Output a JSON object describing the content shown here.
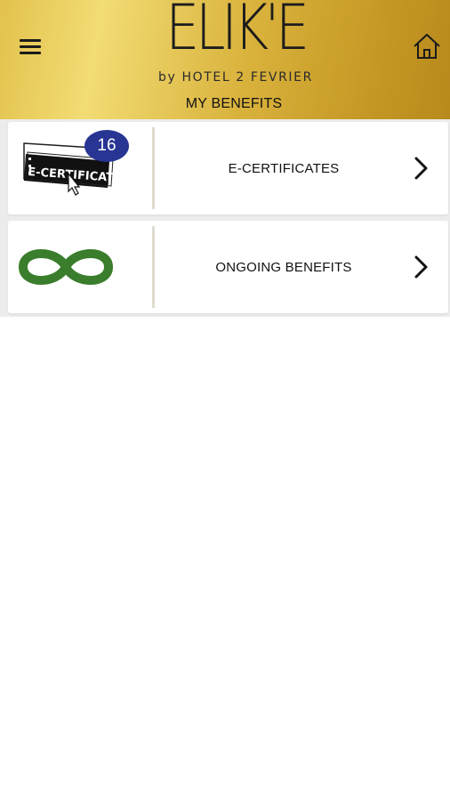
{
  "header": {
    "logo_word": "ELIK'E",
    "logo_sub": "by HOTEL 2 FEVRIER",
    "title": "MY BENEFITS",
    "menu_icon": "hamburger-menu-icon",
    "home_icon": "home-icon"
  },
  "items": [
    {
      "label": "E-CERTIFICATES",
      "thumb_text": "E-CERTIFICATE",
      "thumb_icon": "e-certificate-ticket-icon",
      "badge_count": "16",
      "chevron_icon": "chevron-right-icon"
    },
    {
      "label": "ONGOING BENEFITS",
      "thumb_icon": "infinity-icon",
      "chevron_icon": "chevron-right-icon"
    }
  ],
  "colors": {
    "header_gold": "#d9b23c",
    "badge_blue": "#283593",
    "infinity_green": "#3a7d2c",
    "list_background": "#ececec"
  }
}
